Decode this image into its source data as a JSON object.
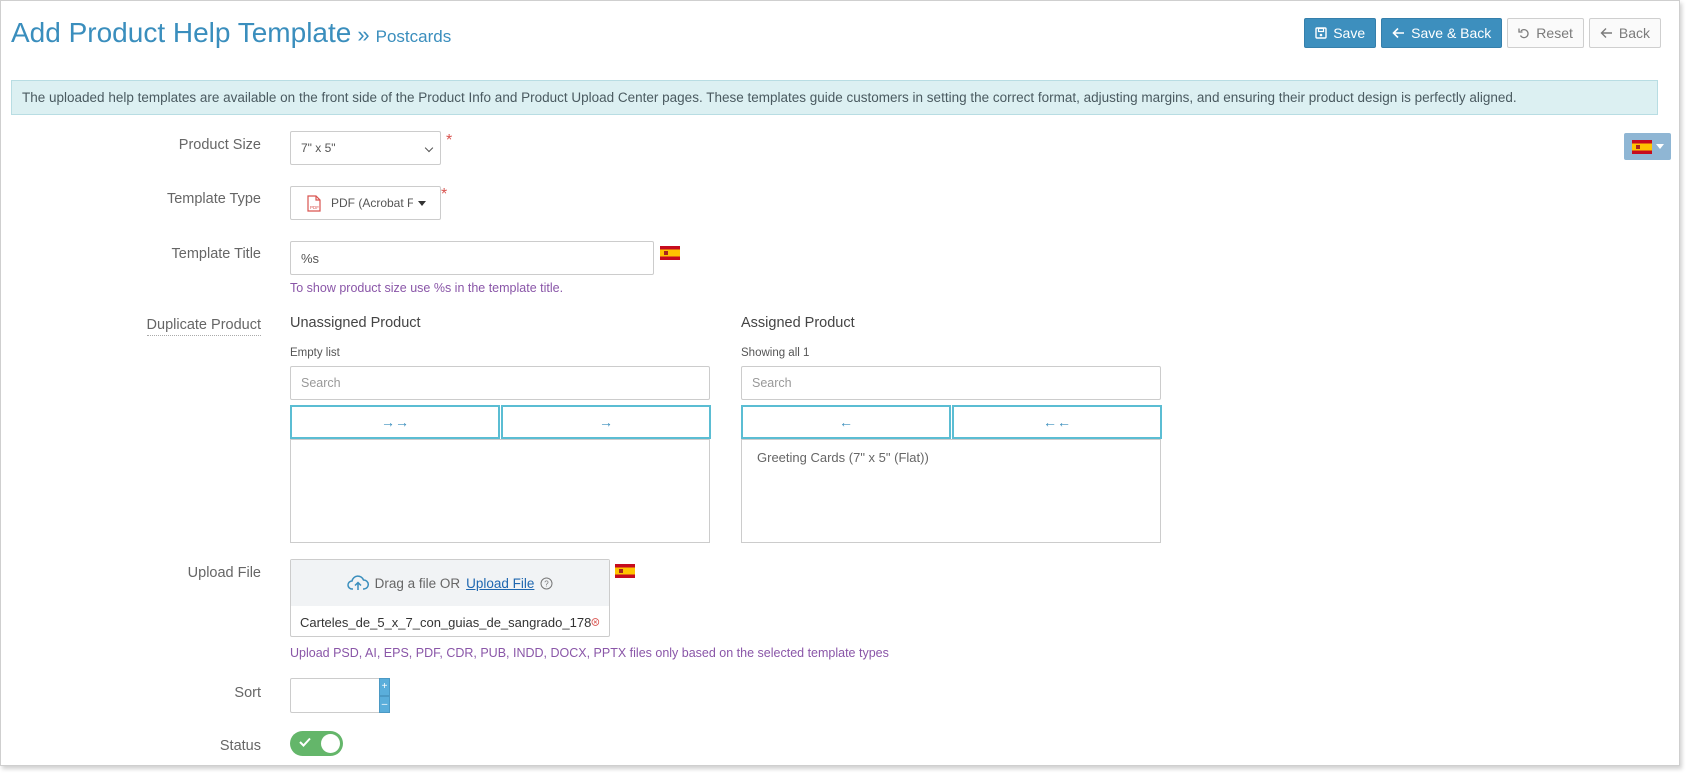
{
  "header": {
    "title": "Add Product Help Template",
    "separator": "»",
    "subtitle": "Postcards"
  },
  "toolbar": {
    "save_label": "Save",
    "save_back_label": "Save & Back",
    "reset_label": "Reset",
    "back_label": "Back"
  },
  "info_text": "The uploaded help templates are available on the front side of the Product Info and Product Upload Center pages. These templates guide customers in setting the correct format, adjusting margins, and ensuring their product design is perfectly aligned.",
  "form": {
    "product_size": {
      "label": "Product Size",
      "value": "7\" x 5\"",
      "required": "*"
    },
    "template_type": {
      "label": "Template Type",
      "value": "PDF (Acrobat F",
      "icon": "pdf-icon",
      "required": "*"
    },
    "template_title": {
      "label": "Template Title",
      "value": "%s",
      "hint": "To show product size use %s in the template title."
    },
    "duplicate_product": {
      "label": "Duplicate Product",
      "unassigned": {
        "title": "Unassigned Product",
        "count": "Empty list",
        "search_placeholder": "Search",
        "move_all": "→→",
        "move_one": "→"
      },
      "assigned": {
        "title": "Assigned Product",
        "count": "Showing all 1",
        "search_placeholder": "Search",
        "remove_one": "←",
        "remove_all": "←←",
        "items": [
          "Greeting Cards (7\" x 5\" (Flat))"
        ]
      }
    },
    "upload_file": {
      "label": "Upload File",
      "drag_text": "Drag a file OR",
      "upload_link": "Upload File",
      "file_name": "Carteles_de_5_x_7_con_guias_de_sangrado_178",
      "hint": "Upload PSD, AI, EPS, PDF, CDR, PUB, INDD, DOCX, PPTX files only based on the selected template types"
    },
    "sort": {
      "label": "Sort",
      "value": "",
      "plus": "+",
      "minus": "–"
    },
    "status": {
      "label": "Status",
      "enabled": true
    }
  },
  "colors": {
    "primary": "#3d8fbe",
    "info_bg": "#dcf0f2",
    "hint": "#8a56a8",
    "toggle_on": "#64b66a",
    "required": "#d9534f"
  }
}
